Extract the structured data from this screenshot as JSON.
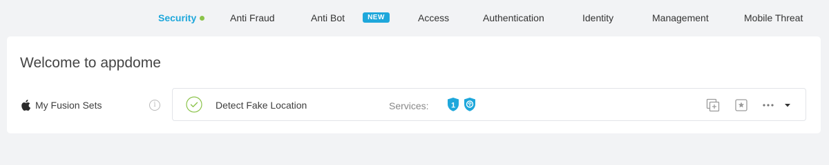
{
  "nav": {
    "items": [
      {
        "label": "Security",
        "active": true
      },
      {
        "label": "Anti Fraud"
      },
      {
        "label": "Anti Bot",
        "badge": "NEW"
      },
      {
        "label": "Access"
      },
      {
        "label": "Authentication"
      },
      {
        "label": "Identity"
      },
      {
        "label": "Management"
      },
      {
        "label": "Mobile Threat"
      }
    ]
  },
  "main": {
    "welcome": "Welcome to appdome",
    "fusion_sets_label": "My Fusion Sets",
    "info_glyph": "i",
    "fusion_set": {
      "name": "Detect Fake Location",
      "services_label": "Services:",
      "service_badge_number": "1"
    }
  },
  "colors": {
    "accent": "#1ea7db",
    "active_dot": "#8bc34a",
    "check": "#8bc34a",
    "background": "#f2f3f5"
  },
  "icons": [
    "apple-icon",
    "info-icon",
    "check-circle-icon",
    "shield-number-icon",
    "shield-fingerprint-icon",
    "duplicate-icon",
    "favorite-icon",
    "more-icon",
    "caret-down-icon"
  ]
}
